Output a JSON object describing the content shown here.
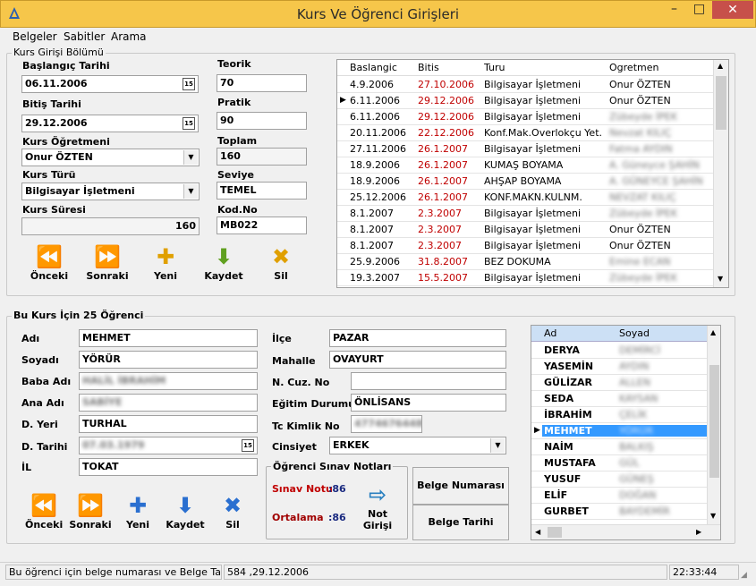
{
  "window": {
    "title": "Kurs Ve Öğrenci Girişleri",
    "minimize": "–",
    "maximize": "□",
    "close": "✕"
  },
  "menu": [
    "Belgeler",
    "Sabitler",
    "Arama"
  ],
  "kurs": {
    "group_label": "Kurs Girişi Bölümü",
    "baslangic_label": "Başlangıç Tarihi",
    "baslangic": "06.11.2006",
    "bitis_label": "Bitiş Tarihi",
    "bitis": "29.12.2006",
    "ogretmen_label": "Kurs Öğretmeni",
    "ogretmen": "Onur ÖZTEN",
    "turu_label": "Kurs Türü",
    "turu": "Bilgisayar İşletmeni",
    "suresi_label": "Kurs Süresi",
    "suresi": "160",
    "teorik_label": "Teorik",
    "teorik": "70",
    "pratik_label": "Pratik",
    "pratik": "90",
    "toplam_label": "Toplam",
    "toplam": "160",
    "seviye_label": "Seviye",
    "seviye": "TEMEL",
    "kod_label": "Kod.No",
    "kod": "MB022",
    "cal_icon": "15",
    "buttons": [
      "Önceki",
      "Sonraki",
      "Yeni",
      "Kaydet",
      "Sil"
    ]
  },
  "kurs_grid": {
    "headers": [
      "Baslangic",
      "Bitis",
      "Turu",
      "Ogretmen"
    ],
    "rows": [
      [
        "4.9.2006",
        "27.10.2006",
        "Bilgisayar İşletmeni",
        "Onur ÖZTEN"
      ],
      [
        "6.11.2006",
        "29.12.2006",
        "Bilgisayar İşletmeni",
        "Onur ÖZTEN"
      ],
      [
        "6.11.2006",
        "29.12.2006",
        "Bilgisayar İşletmeni",
        "Zübeyde İPEK"
      ],
      [
        "20.11.2006",
        "22.12.2006",
        "Konf.Mak.Overlokçu Yet.",
        "Nevzat KILIÇ"
      ],
      [
        "27.11.2006",
        "26.1.2007",
        "Bilgisayar İşletmeni",
        "Fatma AYDIN"
      ],
      [
        "18.9.2006",
        "26.1.2007",
        "KUMAŞ BOYAMA",
        "A. Güneyce ŞAHİN"
      ],
      [
        "18.9.2006",
        "26.1.2007",
        "AHŞAP BOYAMA",
        "A. GÜNEYCE ŞAHİN"
      ],
      [
        "25.12.2006",
        "26.1.2007",
        "KONF.MAKN.KULNM.",
        "NEVZAT KILIÇ"
      ],
      [
        "8.1.2007",
        "2.3.2007",
        "Bilgisayar İşletmeni",
        "Zübeyde İPEK"
      ],
      [
        "8.1.2007",
        "2.3.2007",
        "Bilgisayar İşletmeni",
        "Onur ÖZTEN"
      ],
      [
        "8.1.2007",
        "2.3.2007",
        "Bilgisayar İşletmeni",
        "Onur ÖZTEN"
      ],
      [
        "25.9.2006",
        "31.8.2007",
        "BEZ DOKUMA",
        "Emine ECAN"
      ],
      [
        "19.3.2007",
        "15.5.2007",
        "Bilgisayar İşletmeni",
        "Zübeyde İPEK"
      ]
    ],
    "current_row": 1
  },
  "ogrenci": {
    "group_label": "Bu Kurs İçin 25 Öğrenci",
    "adi_label": "Adı",
    "adi": "MEHMET",
    "soyadi_label": "Soyadı",
    "soyadi": "YÖRÜR",
    "baba_label": "Baba Adı",
    "baba": "HALİL İBRAHİM",
    "ana_label": "Ana Adı",
    "ana": "SABİYE",
    "dyeri_label": "D. Yeri",
    "dyeri": "TURHAL",
    "dtarihi_label": "D. Tarihi",
    "dtarihi": "07.03.1979",
    "il_label": "İL",
    "il": "TOKAT",
    "ilce_label": "İlçe",
    "ilce": "PAZAR",
    "mahalle_label": "Mahalle",
    "mahalle": "OVAYURT",
    "cuz_label": "N. Cuz. No",
    "cuz": "",
    "egitim_label": "Eğitim Durumu",
    "egitim": "ÖNLİSANS",
    "tc_label": "Tc Kimlik No",
    "tc": "47746764480",
    "cinsiyet_label": "Cinsiyet",
    "cinsiyet": "ERKEK",
    "buttons": [
      "Önceki",
      "Sonraki",
      "Yeni",
      "Kaydet",
      "Sil"
    ]
  },
  "notlar": {
    "group_label": "Öğrenci Sınav Notları",
    "sinav_label": "Sınav Notu",
    "sinav": ":86",
    "ortalama_label": "Ortalama",
    "ortalama": ":86",
    "not_girisi": "Not Girişi"
  },
  "belge": {
    "numarasi": "Belge Numarası",
    "tarihi": "Belge Tarihi"
  },
  "ogrenci_grid": {
    "headers": [
      "Ad",
      "Soyad"
    ],
    "rows": [
      [
        "DERYA",
        "DEMİRCİ"
      ],
      [
        "YASEMİN",
        "AYDIN"
      ],
      [
        "GÜLİZAR",
        "ALLEN"
      ],
      [
        "SEDA",
        "KAYSAN"
      ],
      [
        "İBRAHİM",
        "ÇELİK"
      ],
      [
        "MEHMET",
        "YÖRÜR"
      ],
      [
        "NAİM",
        "BALKIŞ"
      ],
      [
        "MUSTAFA",
        "GÜL"
      ],
      [
        "YUSUF",
        "GÜNEŞ"
      ],
      [
        "ELİF",
        "DOĞAN"
      ],
      [
        "GURBET",
        "BAYDEMİR"
      ]
    ],
    "current_row": 5
  },
  "status": {
    "message": "Bu öğrenci için belge numarası ve Belge Tarih",
    "belge": "584 ,29.12.2006",
    "time": "22:33:44"
  },
  "colors": {
    "titlebar": "#f6c64a",
    "close": "#c7504a",
    "selection": "#3399ff",
    "date_red": "#c00000",
    "sinav_red": "#c00000",
    "ortalama_red": "#a00000",
    "header_blue": "#cce0f5"
  }
}
